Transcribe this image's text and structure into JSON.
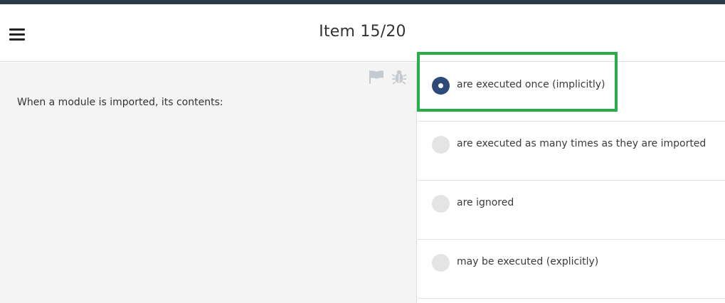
{
  "header": {
    "title": "Item 15/20"
  },
  "question": {
    "text": "When a module is imported, its contents:"
  },
  "answers": [
    {
      "label": "are executed once (implicitly)",
      "selected": true
    },
    {
      "label": "are executed as many times as they are imported",
      "selected": false
    },
    {
      "label": "are ignored",
      "selected": false
    },
    {
      "label": "may be executed (explicitly)",
      "selected": false
    }
  ],
  "colors": {
    "top_strip": "#2b3a4a",
    "selected_radio": "#2d4a79",
    "highlight": "#27ae48",
    "question_bg": "#f4f4f4"
  },
  "icons": {
    "menu": "hamburger-menu-icon",
    "flag": "flag-icon",
    "bug": "bug-icon"
  }
}
